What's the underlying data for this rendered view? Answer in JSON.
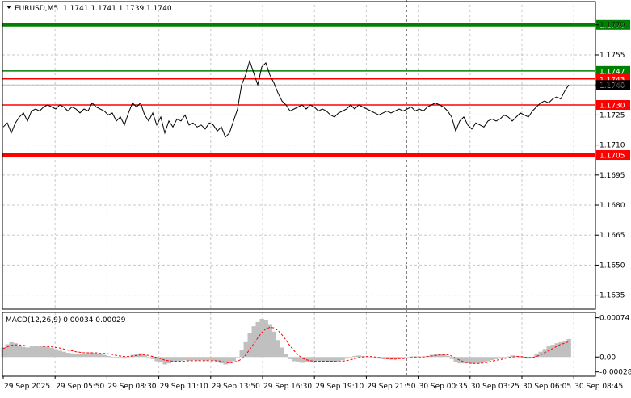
{
  "header": {
    "symbol": "EURUSD,M5",
    "ohlc": "1.1741 1.1741 1.1739 1.1740"
  },
  "colors": {
    "background": "#ffffff",
    "grid": "#c8c8c8",
    "price_line": "#000000",
    "green_level": "#008000",
    "red_level": "#ff0000",
    "macd_hist": "#c0c0c0",
    "macd_signal": "#ff0000",
    "current_price_bg": "#000000"
  },
  "chart_data": [
    {
      "type": "line",
      "title": "EURUSD,M5",
      "price_ticks": [
        "1.1635",
        "1.1650",
        "1.1665",
        "1.1680",
        "1.1695",
        "1.1710",
        "1.1725",
        "1.1740",
        "1.1755",
        "1.1770"
      ],
      "ylim": [
        1.1628,
        1.178
      ],
      "time_labels": [
        "29 Sep 2025",
        "29 Sep 05:50",
        "29 Sep 08:30",
        "29 Sep 11:10",
        "29 Sep 13:50",
        "29 Sep 16:30",
        "29 Sep 19:10",
        "29 Sep 21:50",
        "30 Sep 00:35",
        "30 Sep 03:25",
        "30 Sep 06:05",
        "30 Sep 08:45"
      ],
      "levels": [
        {
          "label": "1.1770",
          "value": 1.177,
          "color": "#008000",
          "style": "thick"
        },
        {
          "label": "1.1747",
          "value": 1.1747,
          "color": "#008000",
          "style": "thin"
        },
        {
          "label": "1.1743",
          "value": 1.1743,
          "color": "#ff0000",
          "style": "thin"
        },
        {
          "label": "1.1730",
          "value": 1.173,
          "color": "#ff0000",
          "style": "thin"
        },
        {
          "label": "1.1705",
          "value": 1.1705,
          "color": "#ff0000",
          "style": "thick"
        }
      ],
      "current_price": "1.1740",
      "x": [
        0,
        5,
        10,
        15,
        20,
        25,
        30,
        35,
        40,
        45,
        50,
        55,
        60,
        65,
        70,
        75,
        80,
        85,
        90,
        95,
        100,
        105,
        110,
        115,
        120,
        125,
        130,
        135,
        140,
        145,
        150,
        155,
        160,
        165,
        170,
        175,
        180,
        185,
        190,
        195,
        200,
        205,
        210,
        215,
        220,
        225,
        230,
        235,
        240,
        245,
        250,
        255,
        260,
        265,
        270,
        275,
        280,
        285,
        290,
        295,
        300,
        305,
        310,
        315,
        320,
        325,
        330,
        335,
        340,
        345,
        350,
        355,
        360,
        365,
        370,
        375,
        380,
        385,
        390,
        395,
        400,
        405,
        410,
        415,
        420,
        425,
        430,
        435,
        440,
        445,
        450,
        455,
        460,
        465,
        470,
        475,
        480,
        485,
        490,
        495,
        500,
        505,
        510,
        515,
        520,
        525,
        530,
        535,
        540,
        545,
        550,
        555,
        560,
        565,
        570,
        575,
        580,
        585,
        590,
        595,
        600,
        605,
        610,
        615,
        620,
        625,
        630,
        635,
        640,
        645,
        650,
        655,
        660,
        665,
        670,
        675,
        680,
        685,
        690,
        695,
        700,
        705,
        710,
        715,
        720
      ],
      "values": [
        1.1719,
        1.1721,
        1.1716,
        1.1721,
        1.1724,
        1.1726,
        1.1722,
        1.1727,
        1.1728,
        1.1727,
        1.1729,
        1.173,
        1.1729,
        1.1728,
        1.173,
        1.1729,
        1.1727,
        1.1729,
        1.1728,
        1.1726,
        1.1728,
        1.1727,
        1.1731,
        1.1729,
        1.1728,
        1.1727,
        1.1725,
        1.1726,
        1.1722,
        1.1724,
        1.172,
        1.1726,
        1.1731,
        1.1729,
        1.1731,
        1.1725,
        1.1722,
        1.1726,
        1.172,
        1.1724,
        1.1716,
        1.1722,
        1.1719,
        1.1723,
        1.1722,
        1.1725,
        1.172,
        1.1721,
        1.1719,
        1.172,
        1.1718,
        1.1721,
        1.172,
        1.1717,
        1.1719,
        1.1714,
        1.1716,
        1.1722,
        1.1728,
        1.174,
        1.1745,
        1.1752,
        1.1746,
        1.174,
        1.1749,
        1.1751,
        1.1745,
        1.1741,
        1.1736,
        1.1732,
        1.173,
        1.1727,
        1.1728,
        1.1729,
        1.173,
        1.1728,
        1.173,
        1.1729,
        1.1727,
        1.1728,
        1.1727,
        1.1725,
        1.1724,
        1.1726,
        1.1727,
        1.1728,
        1.173,
        1.1728,
        1.173,
        1.1729,
        1.1728,
        1.1727,
        1.1726,
        1.1725,
        1.1726,
        1.1727,
        1.1726,
        1.1727,
        1.1728,
        1.1727,
        1.1728,
        1.1729,
        1.1727,
        1.1728,
        1.1727,
        1.1729,
        1.173,
        1.1731,
        1.173,
        1.1729,
        1.1727,
        1.1724,
        1.1717,
        1.1722,
        1.1724,
        1.172,
        1.1718,
        1.1721,
        1.172,
        1.1719,
        1.1722,
        1.1723,
        1.1722,
        1.1723,
        1.1725,
        1.1724,
        1.1722,
        1.1724,
        1.1726,
        1.1725,
        1.1724,
        1.1727,
        1.1729,
        1.1731,
        1.1732,
        1.1731,
        1.1733,
        1.1734,
        1.1733,
        1.1737,
        1.174
      ]
    },
    {
      "type": "bar",
      "title": "MACD(12,26,9) 0.00034 0.00029",
      "y_ticks": [
        "0.00074",
        "0.00",
        "-0.00028"
      ],
      "ylim": [
        -0.0003,
        0.00078
      ],
      "x": [
        0,
        5,
        10,
        15,
        20,
        25,
        30,
        35,
        40,
        45,
        50,
        55,
        60,
        65,
        70,
        75,
        80,
        85,
        90,
        95,
        100,
        105,
        110,
        115,
        120,
        125,
        130,
        135,
        140,
        145,
        150,
        155,
        160,
        165,
        170,
        175,
        180,
        185,
        190,
        195,
        200,
        205,
        210,
        215,
        220,
        225,
        230,
        235,
        240,
        245,
        250,
        255,
        260,
        265,
        270,
        275,
        280,
        285,
        290,
        295,
        300,
        305,
        310,
        315,
        320,
        325,
        330,
        335,
        340,
        345,
        350,
        355,
        360,
        365,
        370,
        375,
        380,
        385,
        390,
        395,
        400,
        405,
        410,
        415,
        420,
        425,
        430,
        435,
        440,
        445,
        450,
        455,
        460,
        465,
        470,
        475,
        480,
        485,
        490,
        495,
        500,
        505,
        510,
        515,
        520,
        525,
        530,
        535,
        540,
        545,
        550,
        555,
        560,
        565,
        570,
        575,
        580,
        585,
        590,
        595,
        600,
        605,
        610,
        615,
        620,
        625,
        630,
        635,
        640,
        645,
        650,
        655,
        660,
        665,
        670,
        675,
        680,
        685,
        690,
        695,
        700,
        705,
        710,
        715,
        720
      ],
      "histogram": [
        0.00018,
        0.00024,
        0.00028,
        0.00026,
        0.00022,
        0.00019,
        0.00018,
        0.0002,
        0.00021,
        0.0002,
        0.0002,
        0.00019,
        0.00017,
        0.00015,
        0.00012,
        0.0001,
        8e-05,
        7e-05,
        6e-05,
        5e-05,
        6e-05,
        7e-05,
        8e-05,
        7e-05,
        6e-05,
        4e-05,
        2e-05,
        0.0,
        -2e-05,
        -1e-05,
        -3e-05,
        1e-05,
        4e-05,
        6e-05,
        7e-05,
        3e-05,
        -1e-05,
        -4e-05,
        -8e-05,
        -0.0001,
        -0.00014,
        -0.00012,
        -0.0001,
        -8e-05,
        -7e-05,
        -6e-05,
        -7e-05,
        -6e-05,
        -7e-05,
        -6e-05,
        -7e-05,
        -6e-05,
        -7e-05,
        -0.0001,
        -0.00012,
        -0.00014,
        -0.00012,
        -8e-05,
        0.0,
        0.00014,
        0.00028,
        0.00045,
        0.00058,
        0.00066,
        0.00072,
        0.0007,
        0.00062,
        0.00048,
        0.00032,
        0.00018,
        6e-05,
        -4e-05,
        -8e-05,
        -0.0001,
        -0.00011,
        -0.0001,
        -9e-05,
        -8e-05,
        -7e-05,
        -8e-05,
        -8e-05,
        -9e-05,
        -0.0001,
        -9e-05,
        -6e-05,
        -3e-05,
        0.0,
        2e-05,
        3e-05,
        2e-05,
        1e-05,
        0.0,
        -1e-05,
        -3e-05,
        -4e-05,
        -4e-05,
        -5e-05,
        -4e-05,
        -2e-05,
        -1e-05,
        0.0,
        1e-05,
        1e-05,
        0.0,
        1e-05,
        2e-05,
        4e-05,
        5e-05,
        6e-05,
        5e-05,
        2e-05,
        -4e-05,
        -0.0001,
        -0.00012,
        -0.00012,
        -0.00012,
        -0.00013,
        -0.00012,
        -0.00012,
        -0.0001,
        -8e-05,
        -6e-05,
        -4e-05,
        -3e-05,
        -1e-05,
        1e-05,
        3e-05,
        2e-05,
        0.0,
        -2e-05,
        -3e-05,
        0.0,
        5e-05,
        0.0001,
        0.00015,
        0.0002,
        0.00023,
        0.00026,
        0.00028,
        0.0003,
        0.00034
      ],
      "signal": [
        0.00016,
        0.00019,
        0.00022,
        0.00023,
        0.00023,
        0.00022,
        0.00021,
        0.00021,
        0.00021,
        0.00021,
        0.0002,
        0.0002,
        0.00019,
        0.00018,
        0.00017,
        0.00015,
        0.00013,
        0.00012,
        0.0001,
        9e-05,
        8e-05,
        8e-05,
        8e-05,
        8e-05,
        7e-05,
        7e-05,
        6e-05,
        5e-05,
        3e-05,
        2e-05,
        1e-05,
        1e-05,
        2e-05,
        3e-05,
        4e-05,
        4e-05,
        3e-05,
        1e-05,
        -1e-05,
        -3e-05,
        -6e-05,
        -7e-05,
        -8e-05,
        -8e-05,
        -8e-05,
        -8e-05,
        -7e-05,
        -7e-05,
        -7e-05,
        -7e-05,
        -7e-05,
        -7e-05,
        -7e-05,
        -7e-05,
        -8e-05,
        -0.0001,
        -0.00011,
        -0.0001,
        -8e-05,
        -4e-05,
        4e-05,
        0.00014,
        0.00025,
        0.00036,
        0.00046,
        0.00053,
        0.00056,
        0.00055,
        0.0005,
        0.00042,
        0.00032,
        0.00021,
        0.00012,
        4e-05,
        -2e-05,
        -5e-05,
        -7e-05,
        -8e-05,
        -8e-05,
        -8e-05,
        -8e-05,
        -8e-05,
        -8e-05,
        -9e-05,
        -8e-05,
        -7e-05,
        -5e-05,
        -3e-05,
        -1e-05,
        0.0,
        1e-05,
        1e-05,
        0.0,
        -1e-05,
        -2e-05,
        -3e-05,
        -3e-05,
        -4e-05,
        -3e-05,
        -3e-05,
        -2e-05,
        -1e-05,
        0.0,
        0.0,
        0.0,
        1e-05,
        2e-05,
        3e-05,
        4e-05,
        4e-05,
        4e-05,
        2e-05,
        -2e-05,
        -6e-05,
        -9e-05,
        -0.00011,
        -0.00012,
        -0.00012,
        -0.00012,
        -0.00011,
        -0.0001,
        -8e-05,
        -6e-05,
        -5e-05,
        -3e-05,
        -1e-05,
        0.0,
        1e-05,
        1e-05,
        0.0,
        -1e-05,
        -1e-05,
        1e-05,
        4e-05,
        8e-05,
        0.00012,
        0.00016,
        0.0002,
        0.00024,
        0.00026,
        0.00029
      ]
    }
  ]
}
